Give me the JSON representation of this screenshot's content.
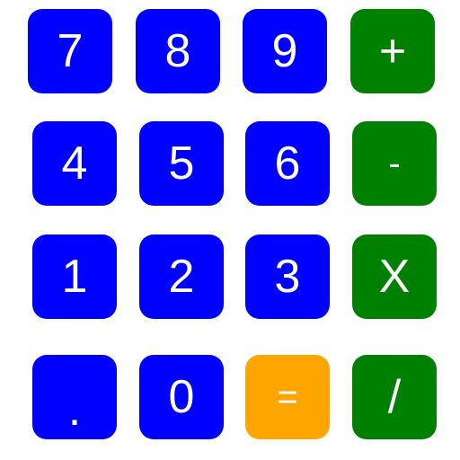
{
  "colors": {
    "digit_key": "#0000ff",
    "operator_key": "#008000",
    "equals_key": "#ffa500",
    "key_text": "#ffffff",
    "background": "#ffffff"
  },
  "keypad": {
    "rows": [
      [
        {
          "label": "7",
          "kind": "digit"
        },
        {
          "label": "8",
          "kind": "digit"
        },
        {
          "label": "9",
          "kind": "digit"
        },
        {
          "label": "+",
          "kind": "operator"
        }
      ],
      [
        {
          "label": "4",
          "kind": "digit"
        },
        {
          "label": "5",
          "kind": "digit"
        },
        {
          "label": "6",
          "kind": "digit"
        },
        {
          "label": "-",
          "kind": "operator"
        }
      ],
      [
        {
          "label": "1",
          "kind": "digit"
        },
        {
          "label": "2",
          "kind": "digit"
        },
        {
          "label": "3",
          "kind": "digit"
        },
        {
          "label": "X",
          "kind": "operator"
        }
      ],
      [
        {
          "label": ".",
          "kind": "digit"
        },
        {
          "label": "0",
          "kind": "digit"
        },
        {
          "label": "=",
          "kind": "equals"
        },
        {
          "label": "/",
          "kind": "operator"
        }
      ]
    ]
  }
}
